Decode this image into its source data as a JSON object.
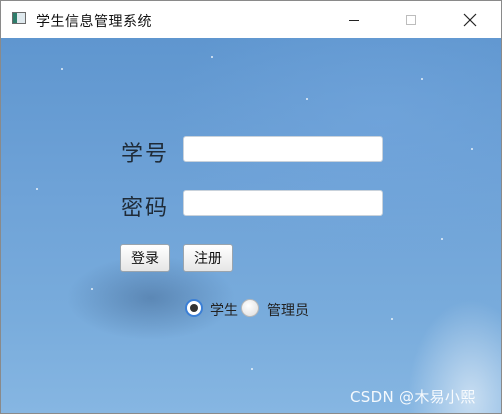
{
  "window": {
    "title": "学生信息管理系统"
  },
  "form": {
    "id_label": "学号",
    "id_value": "",
    "password_label": "密码",
    "password_value": ""
  },
  "buttons": {
    "login": "登录",
    "register": "注册"
  },
  "role": {
    "options": [
      "学生",
      "管理员"
    ],
    "selected": "学生"
  },
  "watermark": "CSDN @木易小熙",
  "colors": {
    "background": "#6ea2d7",
    "radio_accent": "#3b7fd6"
  }
}
